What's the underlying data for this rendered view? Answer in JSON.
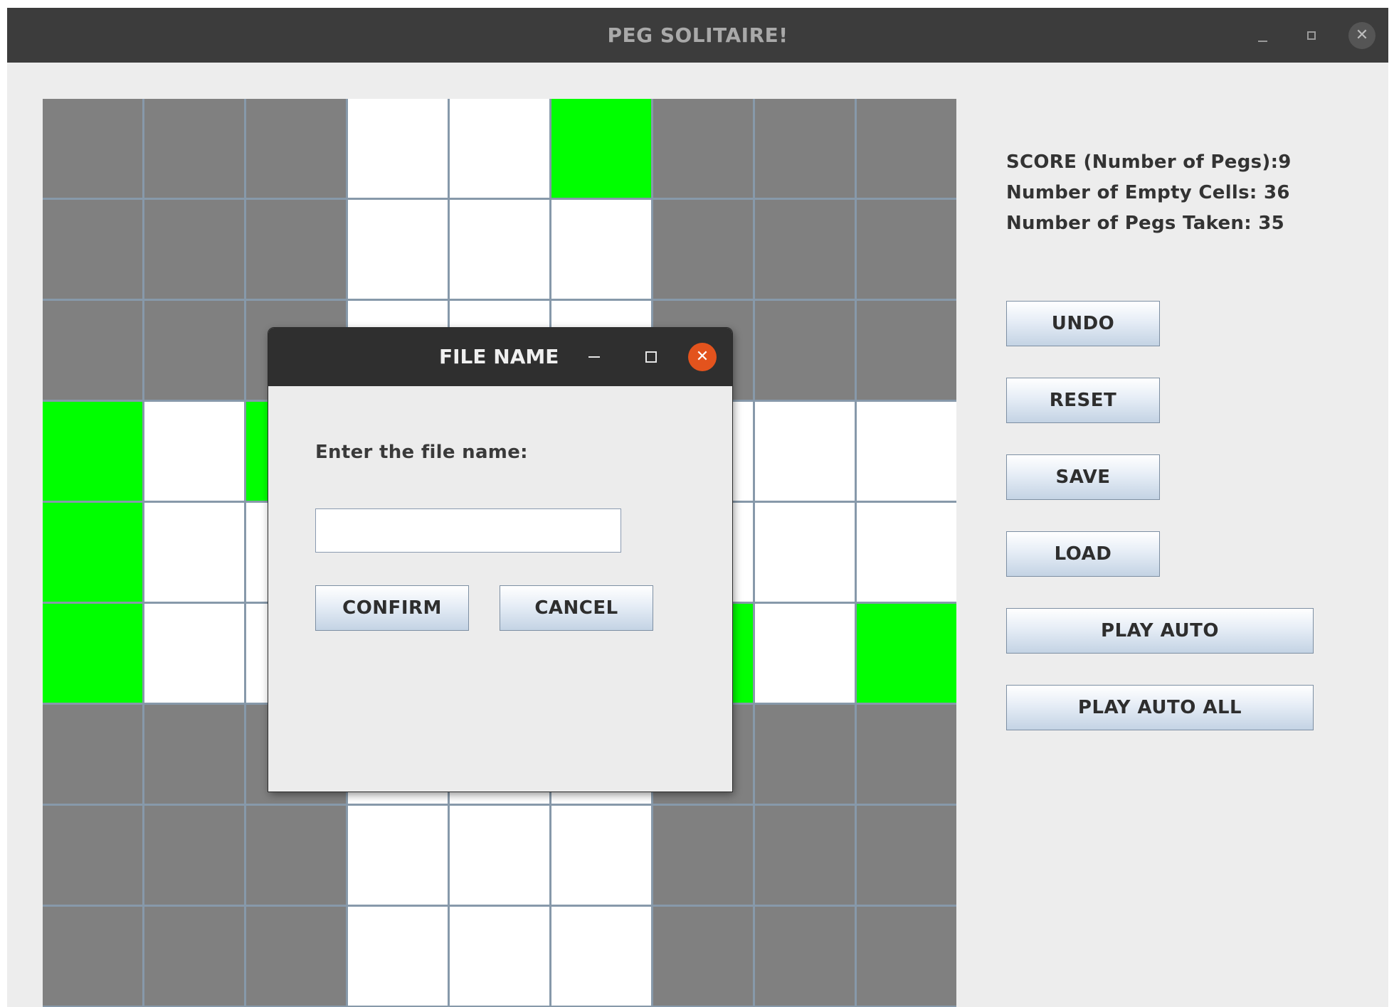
{
  "window": {
    "title": "PEG SOLITAIRE!",
    "controls": {
      "minimize": "minimize",
      "maximize": "maximize",
      "close": "✕"
    }
  },
  "board": {
    "rows": 9,
    "cols": 9,
    "legend": {
      "X": "invalid",
      "O": "empty",
      "P": "peg"
    },
    "grid": [
      "XXXOOPXXX",
      "XXXOOOXXX",
      "XXXOOOXXX",
      "POPOOOOOO",
      "POOOOOOOO",
      "POOOOOPOP",
      "XXXOOOXXX",
      "XXXOOOXXX",
      "XXXOOOXXX"
    ],
    "colors": {
      "invalid": "#808080",
      "empty": "#ffffff",
      "peg": "#00ff00",
      "grid_line": "#8799aa"
    }
  },
  "stats": {
    "score": "SCORE (Number of Pegs):9",
    "empty_cells": "Number of Empty Cells: 36",
    "pegs_taken": "Number of Pegs Taken: 35"
  },
  "buttons": {
    "undo": "UNDO",
    "reset": "RESET",
    "save": "SAVE",
    "load": "LOAD",
    "play_auto": "PLAY AUTO",
    "play_auto_all": "PLAY AUTO ALL"
  },
  "dialog": {
    "title": "FILE NAME",
    "prompt": "Enter the file name:",
    "input_value": "",
    "confirm": "CONFIRM",
    "cancel": "CANCEL",
    "close_glyph": "✕"
  }
}
